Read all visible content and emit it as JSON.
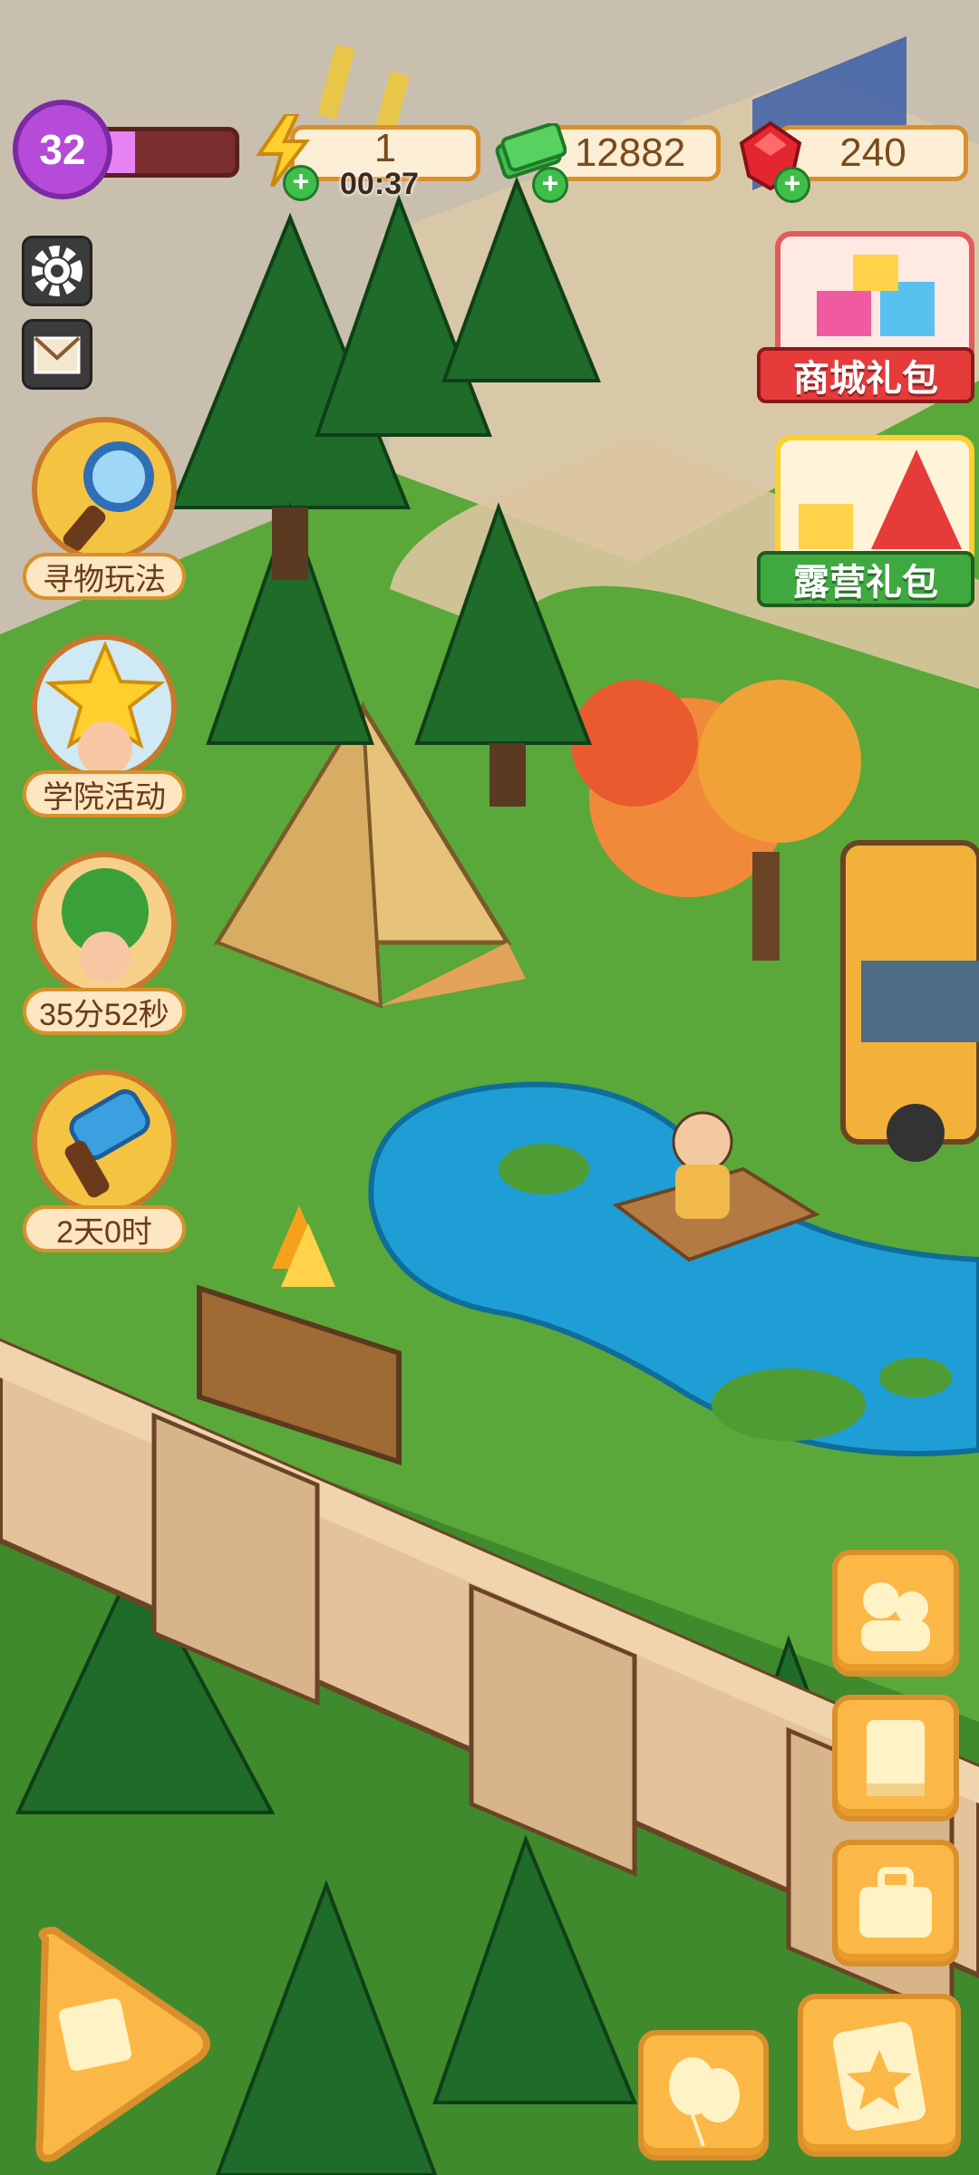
{
  "hud": {
    "level": "32",
    "xp_fraction": 0.35,
    "energy": "1",
    "energy_timer": "00:37",
    "cash": "12882",
    "gems": "240"
  },
  "side_events": [
    {
      "label": "寻物玩法",
      "icon": "magnifier-icon"
    },
    {
      "label": "学院活动",
      "icon": "star-character-icon"
    },
    {
      "label": "35分52秒",
      "icon": "tree-character-icon"
    },
    {
      "label": "2天0时",
      "icon": "hammer-icon"
    }
  ],
  "promos": [
    {
      "label": "商城礼包",
      "icon": "gift-box-icon"
    },
    {
      "label": "露营礼包",
      "icon": "tent-gift-icon"
    }
  ],
  "toolbar": {
    "settings_icon": "gear-icon",
    "mail_icon": "mail-icon",
    "right_buttons": [
      "characters-icon",
      "book-icon",
      "toolbox-icon",
      "clipboard-star-icon"
    ],
    "balloon_icon": "balloons-icon",
    "arrow_icon": "play-arrow-icon"
  },
  "colors": {
    "grass": "#5aa83a",
    "pine": "#1f6b2a",
    "water": "#1f9ed6",
    "accent": "#fbb846",
    "level_purple": "#b54bd8"
  }
}
